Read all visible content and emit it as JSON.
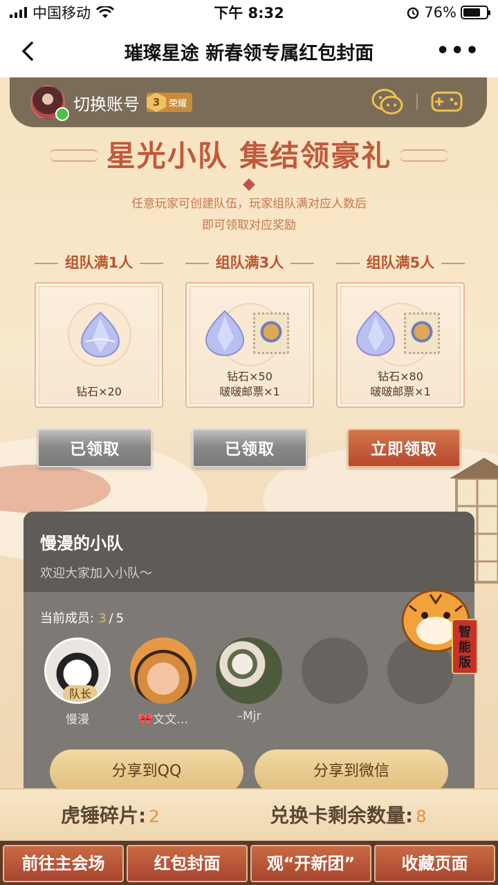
{
  "status_bar": {
    "carrier": "中国移动",
    "time": "下午 8:32",
    "battery": "76%",
    "battery_level": 0.76
  },
  "nav": {
    "title": "璀璨星途 新春领专属红包封面",
    "back_icon": "chevron-left-icon",
    "more_icon": "more-icon",
    "more_text": "•••"
  },
  "account": {
    "switch_label": "切换账号",
    "level": "3",
    "level_text": "荣耀",
    "icons": [
      "chat-icon",
      "gamepad-icon"
    ]
  },
  "event": {
    "title": "星光小队  集结领豪礼",
    "desc_line1": "任意玩家可创建队伍，玩家组队满对应人数后",
    "desc_line2": "即可领取对应奖励"
  },
  "rewards": [
    {
      "tier": "组队满1人",
      "line1": "钻石×20",
      "line2": "",
      "button": "已领取",
      "claimed": true,
      "has_stamp": false
    },
    {
      "tier": "组队满3人",
      "line1": "钻石×50",
      "line2": "啵啵邮票×1",
      "button": "已领取",
      "claimed": true,
      "has_stamp": true
    },
    {
      "tier": "组队满5人",
      "line1": "钻石×80",
      "line2": "啵啵邮票×1",
      "button": "立即领取",
      "claimed": false,
      "has_stamp": true
    }
  ],
  "team": {
    "name": "慢漫的小队",
    "message": "欢迎大家加入小队～",
    "members_label": "当前成员:",
    "members_current": "3",
    "members_sep": "/",
    "members_total": "5",
    "leader_badge": "队长",
    "members": [
      {
        "name": "慢漫",
        "leader": true
      },
      {
        "name": "🎀文文…",
        "leader": false
      },
      {
        "name": "–Mjr",
        "leader": false
      },
      {
        "name": "",
        "leader": false
      },
      {
        "name": "",
        "leader": false
      }
    ],
    "share_qq": "分享到QQ",
    "share_wechat": "分享到微信"
  },
  "mascot": {
    "banner_text": "智能版",
    "icon": "tiger-mascot-icon"
  },
  "stats": {
    "fragments_label": "虎锤碎片:",
    "fragments_value": "2",
    "cards_label": "兑换卡剩余数量:",
    "cards_value": "8"
  },
  "tabs": [
    "前往主会场",
    "红包封面",
    "观“开新团”",
    "收藏页面"
  ]
}
